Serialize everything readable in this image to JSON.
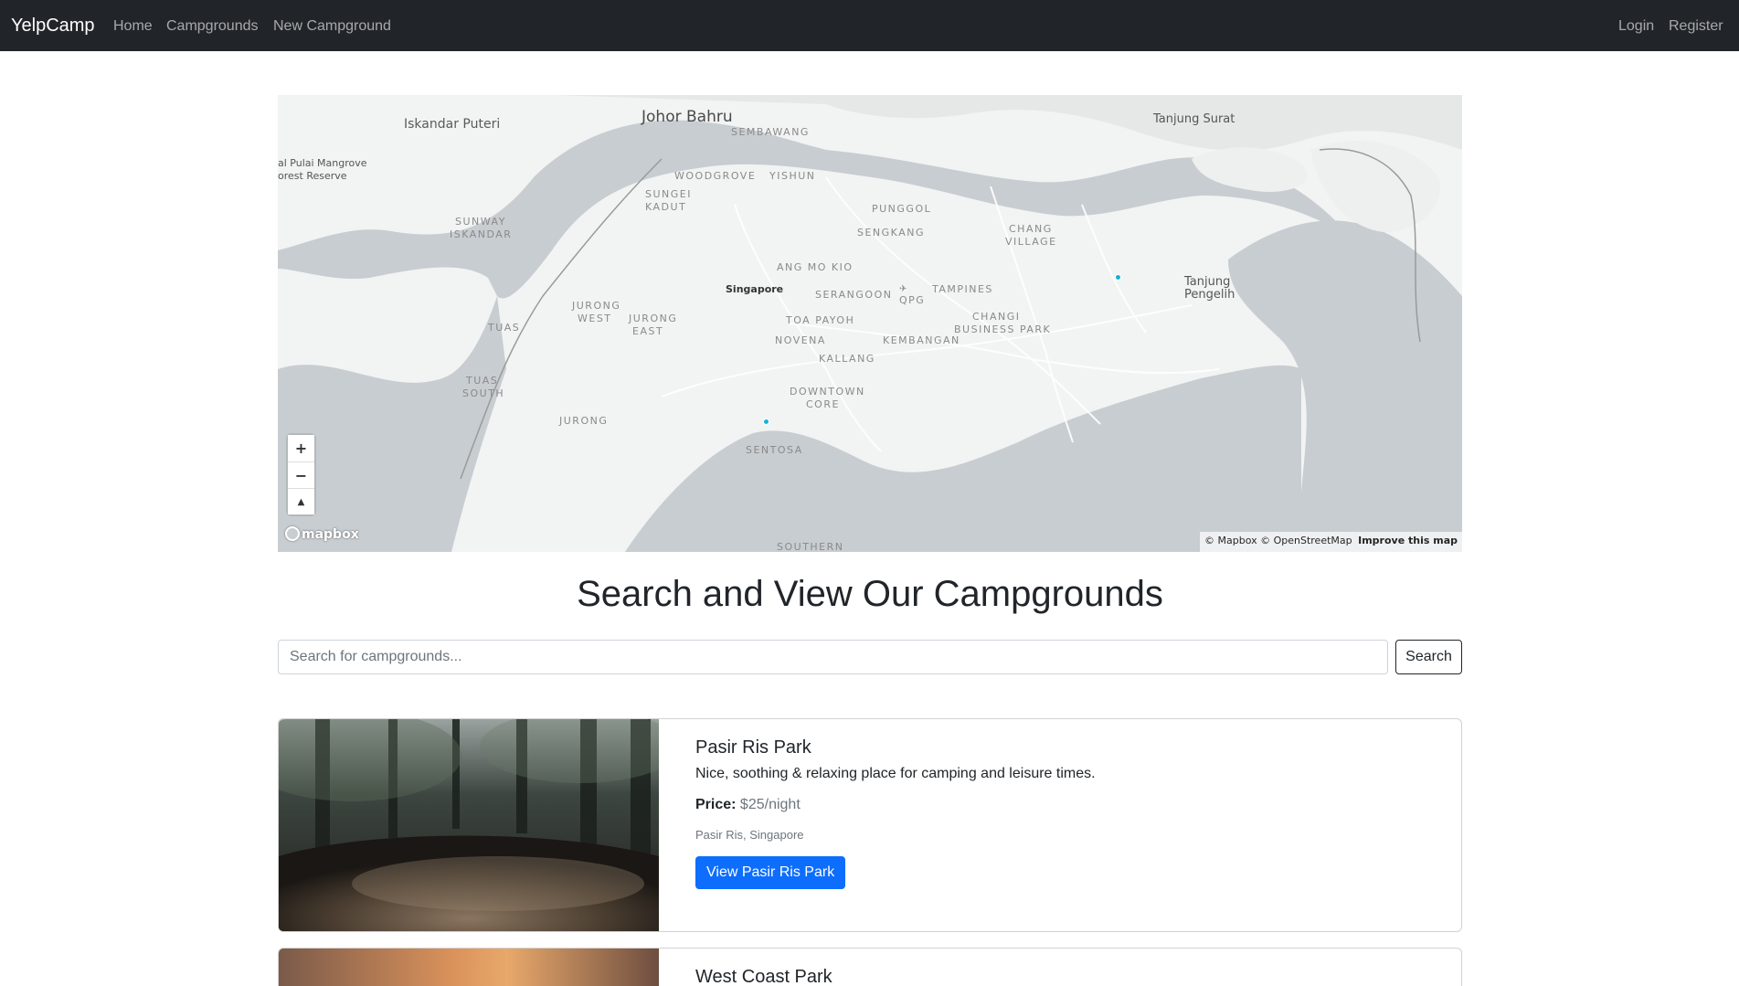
{
  "navbar": {
    "brand": "YelpCamp",
    "links": [
      "Home",
      "Campgrounds",
      "New Campground"
    ],
    "auth": [
      "Login",
      "Register"
    ]
  },
  "map": {
    "labels": {
      "johor_bahru": "Johor Bahru",
      "iskandar_puteri": "Iskandar Puteri",
      "tanjung_surat": "Tanjung Surat",
      "pulai_mangrove": "al Pulai Mangrove",
      "forest_reserve": "orest Reserve",
      "sembawang": "SEMBAWANG",
      "woodgrove": "WOODGROVE",
      "yishun": "YISHUN",
      "sungei": "SUNGEI",
      "kadut": "KADUT",
      "sunway": "SUNWAY",
      "iskandar": "ISKANDAR",
      "punggol": "PUNGGOL",
      "sengkang": "SENGKANG",
      "chang": "CHANG",
      "village": "VILLAGE",
      "tanjung_pengelih_1": "Tanjung",
      "tanjung_pengelih_2": "Pengelih",
      "ang_mo_kio": "ANG MO KIO",
      "singapore": "Singapore",
      "serangoon": "SERANGOON",
      "qpg": "QPG",
      "tampines": "TAMPINES",
      "jurong_west_1": "JURONG",
      "jurong_west_2": "WEST",
      "jurong_east_1": "JURONG",
      "jurong_east_2": "EAST",
      "tuas": "TUAS",
      "toa_payoh": "TOA PAYOH",
      "changi_bp_1": "CHANGI",
      "changi_bp_2": "BUSINESS PARK",
      "novena": "NOVENA",
      "kembangan": "KEMBANGAN",
      "kallang": "KALLANG",
      "tuas_south_1": "TUAS",
      "tuas_south_2": "SOUTH",
      "downtown_1": "DOWNTOWN",
      "downtown_2": "CORE",
      "jurong": "JURONG",
      "sentosa": "SENTOSA",
      "southern": "SOUTHERN"
    },
    "controls": {
      "zoom_in": "+",
      "zoom_out": "−",
      "compass": "▲"
    },
    "logo": "mapbox",
    "attribution": {
      "mapbox": "© Mapbox",
      "osm": "© OpenStreetMap",
      "improve": "Improve this map"
    },
    "marker_color": "#11b4da"
  },
  "heading": "Search and View Our Campgrounds",
  "search": {
    "placeholder": "Search for campgrounds...",
    "button": "Search"
  },
  "campgrounds": [
    {
      "title": "Pasir Ris Park",
      "description": "Nice, soothing & relaxing place for camping and leisure times.",
      "price_label": "Price:",
      "price": "$25/night",
      "location": "Pasir Ris, Singapore",
      "button": "View Pasir Ris Park"
    },
    {
      "title": "West Coast Park"
    }
  ],
  "colors": {
    "navbar": "#212529",
    "primary": "#0d6efd",
    "water": "#c8cdd1",
    "land": "#f2f3f3"
  }
}
